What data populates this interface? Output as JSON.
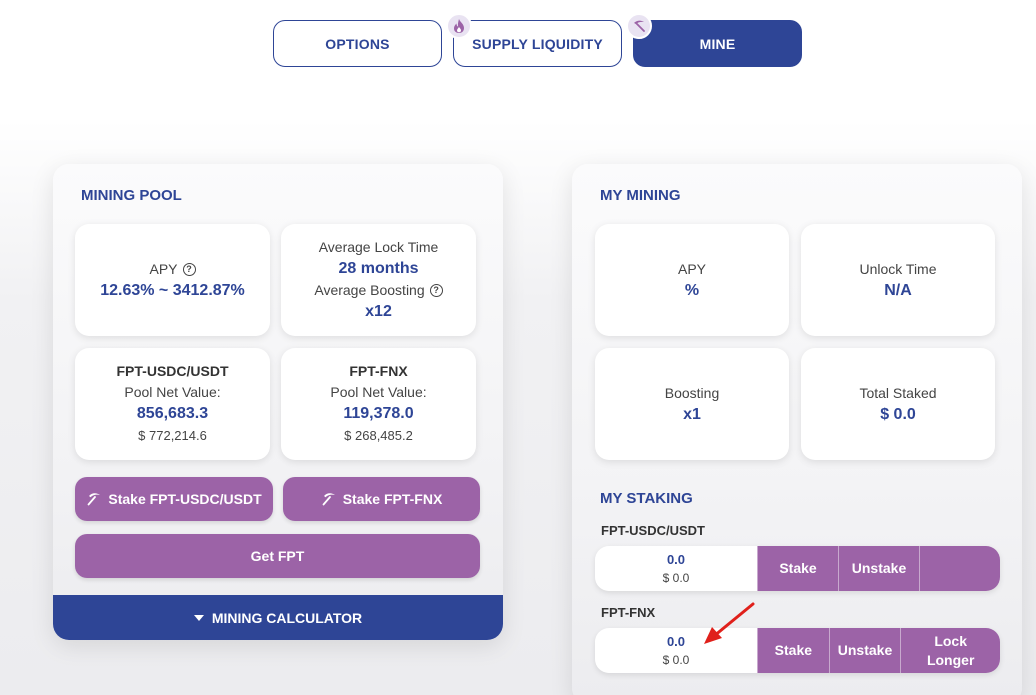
{
  "tabs": [
    {
      "label": "OPTIONS",
      "active": false
    },
    {
      "label": "SUPPLY LIQUIDITY",
      "active": false,
      "badge_icon": "flame-icon"
    },
    {
      "label": "MINE",
      "active": true,
      "badge_icon": "pickaxe-icon"
    }
  ],
  "colors": {
    "primary": "#2e4596",
    "accent": "#9c63a7"
  },
  "mining_pool": {
    "title": "MINING POOL",
    "apy_label": "APY",
    "apy_value": "12.63% ~ 3412.87%",
    "lock_label": "Average Lock Time",
    "lock_value": "28 months",
    "boost_label": "Average Boosting",
    "boost_value": "x12",
    "pools": [
      {
        "name": "FPT-USDC/USDT",
        "nv_label": "Pool Net Value:",
        "value": "856,683.3",
        "usd": "$ 772,214.6"
      },
      {
        "name": "FPT-FNX",
        "nv_label": "Pool Net Value:",
        "value": "119,378.0",
        "usd": "$ 268,485.2"
      }
    ],
    "stake_usdc_btn": "Stake FPT-USDC/USDT",
    "stake_fnx_btn": "Stake FPT-FNX",
    "get_fpt_btn": "Get FPT",
    "calculator_label": "MINING CALCULATOR"
  },
  "my_mining": {
    "title": "MY MINING",
    "apy_label": "APY",
    "apy_value": "%",
    "unlock_label": "Unlock Time",
    "unlock_value": "N/A",
    "boost_label": "Boosting",
    "boost_value": "x1",
    "staked_label": "Total Staked",
    "staked_value": "$ 0.0"
  },
  "my_staking": {
    "title": "MY STAKING",
    "rows": [
      {
        "name": "FPT-USDC/USDT",
        "amount": "0.0",
        "usd": "$ 0.0",
        "stake": "Stake",
        "unstake": "Unstake",
        "lock": ""
      },
      {
        "name": "FPT-FNX",
        "amount": "0.0",
        "usd": "$ 0.0",
        "stake": "Stake",
        "unstake": "Unstake",
        "lock": "Lock Longer"
      }
    ]
  }
}
